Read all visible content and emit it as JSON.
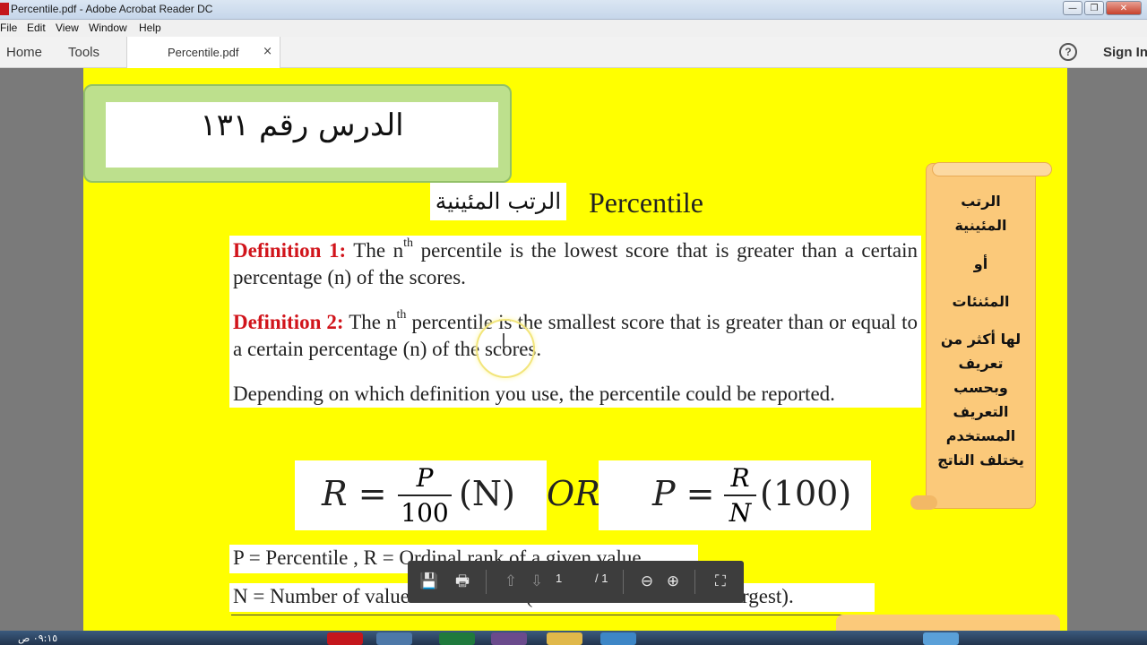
{
  "window": {
    "title": "Percentile.pdf - Adobe Acrobat Reader DC"
  },
  "menu": [
    "File",
    "Edit",
    "View",
    "Window",
    "Help"
  ],
  "toolbar": {
    "home": "Home",
    "tools": "Tools",
    "tab_name": "Percentile.pdf",
    "tab_close": "×",
    "help": "?",
    "sign_in": "Sign In"
  },
  "doc": {
    "lesson_title": "الدرس رقم ١٣١",
    "heading_ar": "الرتب المئينية",
    "heading_en": "Percentile",
    "def1": {
      "label": "Definition 1:",
      "pre": " The n",
      "sup": "th",
      "post": " percentile is the lowest score that is greater than a certain percentage (n) of the scores."
    },
    "def2": {
      "label": "Definition 2:",
      "pre": " The n",
      "sup": "th",
      "post": " percentile is the smallest score that is greater than or equal to a certain percentage (n) of the scores."
    },
    "depending": "Depending on which definition you use, the percentile could be reported.",
    "formula": {
      "left_lhs": "R =",
      "left_num": "P",
      "left_den": "100",
      "left_tail": "(N)",
      "or": "OR",
      "right_lhs": "P =",
      "right_num": "R",
      "right_den": "N",
      "right_tail": "(100)"
    },
    "legend_p": "P = Percentile , R = Ordinal rank of a given value",
    "legend_n": "N = Number of values in a data set (sorted from smallest to largest).",
    "side_note": [
      "الرتب",
      "المئينية",
      "أو",
      "المئنئات",
      "لها أكثر من",
      "تعريف",
      "وبحسب",
      "التعريف",
      "المستخدم",
      "يختلف الناتج"
    ]
  },
  "pagebar": {
    "current": "1",
    "total": "/ 1"
  },
  "taskbar": {
    "clock": "٠٩:١٥ ص"
  }
}
